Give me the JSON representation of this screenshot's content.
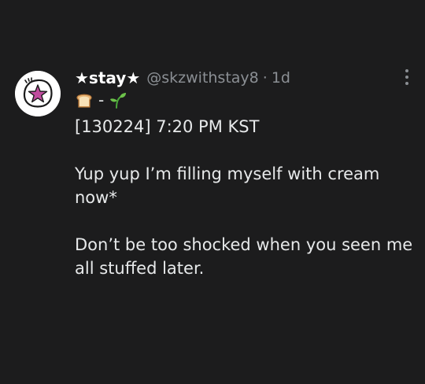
{
  "tweet": {
    "display_name": "★stay★",
    "handle": "@skzwithstay8",
    "separator": "·",
    "time": "1d",
    "emoji_dash": "-",
    "emoji_icons": [
      "bread-icon",
      "seedling-icon"
    ],
    "lines": [
      "[130224] 7:20 PM KST",
      "Yup yup I’m filling myself with cream now*",
      "Don’t be too shocked when you seen me all stuffed later."
    ]
  },
  "colors": {
    "background": "#1c1c1d",
    "text": "#e7e9ea",
    "muted": "#8b8f94",
    "avatar_star": "#c04c9e"
  },
  "more_icon": "more-vertical-icon",
  "avatar_icon": "star-badge-icon"
}
